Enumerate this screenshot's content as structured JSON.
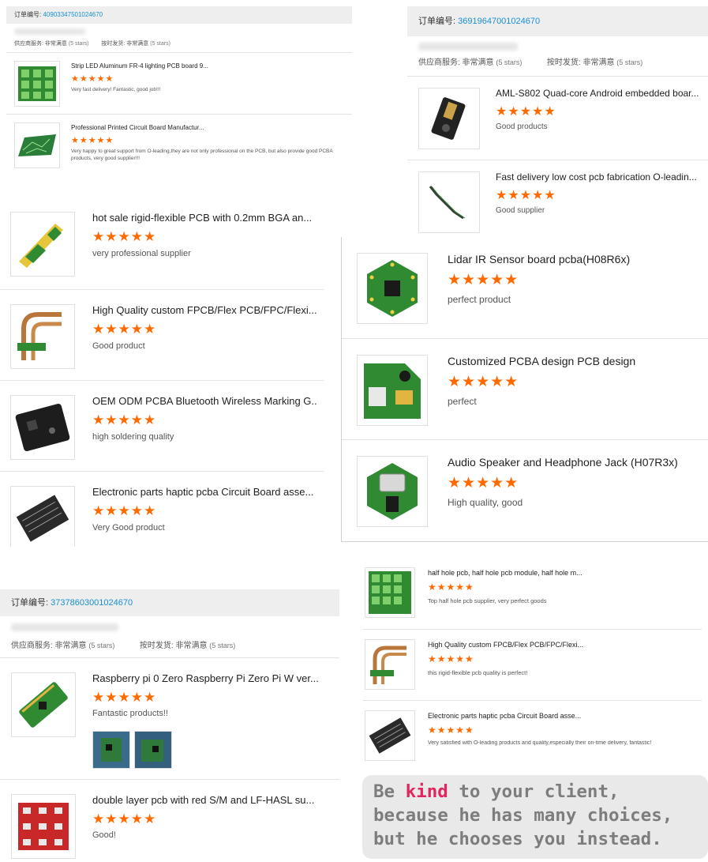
{
  "labels": {
    "order_prefix": "订单编号:",
    "supplier_service": "供应商服务: 非常满意",
    "shipping": "按时发货: 非常满意",
    "stars_note": "(5 stars)",
    "stars": "★★★★★"
  },
  "panel_a": {
    "order_number": "40903347501024670",
    "items": [
      {
        "title": "Strip LED Aluminum FR-4 lighting PCB board 9...",
        "comment": "Very fast delivery! Fantastic, good job!!!"
      },
      {
        "title": "Professional Printed Circuit Board Manufactur...",
        "comment": "Very happy to great support from O-leading,they are not only professional on the PCB, but also provide good PCBA products, very good supplier!!!"
      }
    ]
  },
  "panel_b": {
    "order_number": "36919647001024670",
    "items": [
      {
        "title": "AML-S802 Quad-core Android embedded boar...",
        "comment": "Good products"
      },
      {
        "title": "Fast delivery low cost pcb fabrication O-leadin...",
        "comment": "Good supplier"
      }
    ]
  },
  "panel_c": {
    "items": [
      {
        "title": "hot sale rigid-flexible PCB with 0.2mm BGA an...",
        "comment": "very professional supplier"
      },
      {
        "title": "High Quality custom FPCB/Flex PCB/FPC/Flexi...",
        "comment": "Good product"
      },
      {
        "title": "OEM ODM PCBA Bluetooth Wireless Marking G...",
        "comment": "high soldering quality"
      },
      {
        "title": "Electronic parts haptic pcba Circuit Board asse...",
        "comment": "Very Good product"
      }
    ]
  },
  "panel_d": {
    "items": [
      {
        "title": "Lidar IR Sensor board pcba(H08R6x)",
        "comment": "perfect product"
      },
      {
        "title": "Customized PCBA design PCB design",
        "comment": "perfect"
      },
      {
        "title": "Audio Speaker and Headphone Jack (H07R3x)",
        "comment": "High quality, good"
      }
    ]
  },
  "panel_e": {
    "order_number": "37378603001024670",
    "items": [
      {
        "title": "Raspberry pi 0 Zero Raspberry Pi Zero Pi W ver...",
        "comment": "Fantastic products!!"
      },
      {
        "title": "double layer pcb with red S/M and LF-HASL su...",
        "comment": "Good!"
      }
    ]
  },
  "panel_f": {
    "items": [
      {
        "title": "half hole pcb, half hole pcb module, half hole m...",
        "comment": "Top half hole pcb supplier, very perfect goods"
      },
      {
        "title": "High Quality custom FPCB/Flex PCB/FPC/Flexi...",
        "comment": "this rigid-flexible pcb quality is perfect!"
      },
      {
        "title": "Electronic parts haptic pcba Circuit Board asse...",
        "comment": "Very satisfied with O-leading products and quality,especially their on-time delivery, fantastic!"
      }
    ]
  },
  "quote": {
    "line1_a": "Be ",
    "line1_kind": "kind",
    "line1_b": " to your client,",
    "line2": "because he has many choices,",
    "line3": "but he chooses you instead."
  },
  "colors": {
    "stars": "#ff6a00",
    "order_link": "#1a8fd1",
    "kind": "#e0265c"
  }
}
